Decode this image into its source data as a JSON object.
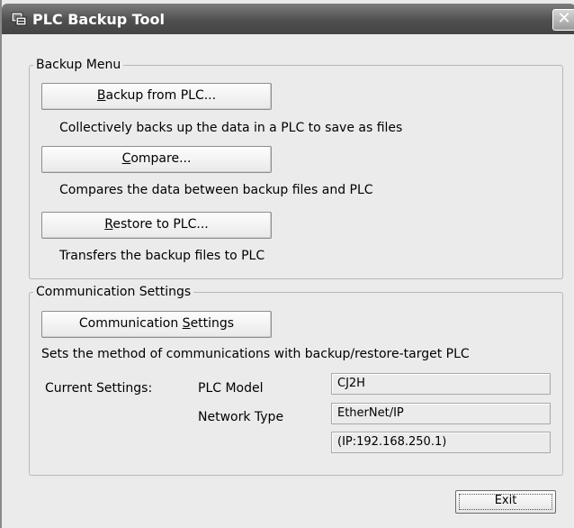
{
  "window": {
    "title": "PLC Backup Tool",
    "close_symbol": "✕"
  },
  "backup_menu": {
    "legend": "Backup Menu",
    "backup_button": {
      "pre": "",
      "accel": "B",
      "post": "ackup from PLC..."
    },
    "backup_desc": "Collectively backs up the data in a PLC to save as files",
    "compare_button": {
      "pre": "",
      "accel": "C",
      "post": "ompare..."
    },
    "compare_desc": "Compares the data between backup files and PLC",
    "restore_button": {
      "pre": "",
      "accel": "R",
      "post": "estore to PLC..."
    },
    "restore_desc": "Transfers the backup files to PLC"
  },
  "comm": {
    "legend": "Communication Settings",
    "button": {
      "pre": "Communication ",
      "accel": "S",
      "post": "ettings"
    },
    "desc": "Sets the method of communications with backup/restore-target PLC",
    "current_label": "Current Settings:",
    "plc_model_label": "PLC Model",
    "plc_model_value": "CJ2H",
    "network_type_label": "Network Type",
    "network_type_value": "EtherNet/IP",
    "ip_value": "(IP:192.168.250.1)"
  },
  "footer": {
    "exit_label": "Exit"
  },
  "icons": {
    "app": "app-icon",
    "close": "close-icon"
  }
}
